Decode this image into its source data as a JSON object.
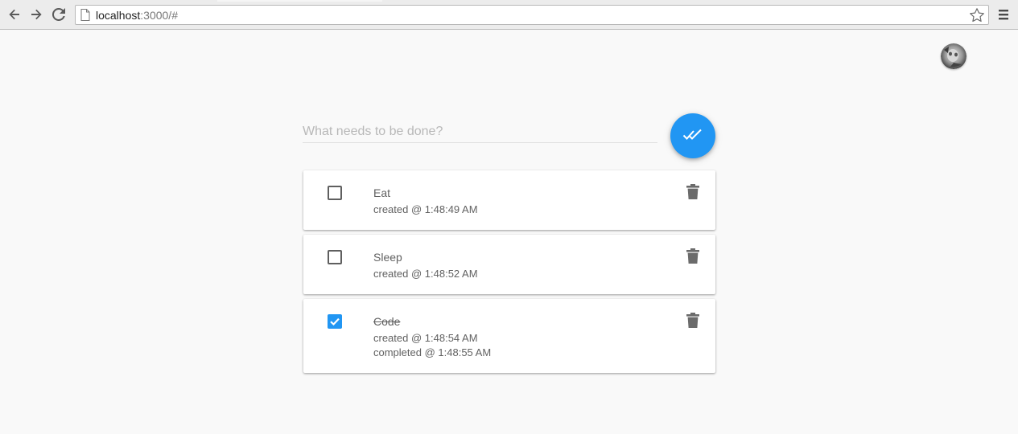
{
  "browser": {
    "url_host": "localhost",
    "url_rest": ":3000/#",
    "icons": [
      "back-icon",
      "forward-icon",
      "reload-icon",
      "page-icon",
      "star-icon",
      "menu-icon"
    ]
  },
  "user": {
    "avatar_icon": "avatar"
  },
  "new_todo": {
    "placeholder": "What needs to be done?",
    "value": "",
    "toggle_all_icon": "double-check-icon"
  },
  "todos": [
    {
      "title": "Eat",
      "created": "created @ 1:48:49 AM",
      "completed": false
    },
    {
      "title": "Sleep",
      "created": "created @ 1:48:52 AM",
      "completed": false
    },
    {
      "title": "Code",
      "created": "created @ 1:48:54 AM",
      "completed_at": "completed @ 1:48:55 AM",
      "completed": true
    }
  ],
  "colors": {
    "accent": "#2196f3",
    "background": "#f9f9f9",
    "text": "#616161"
  }
}
